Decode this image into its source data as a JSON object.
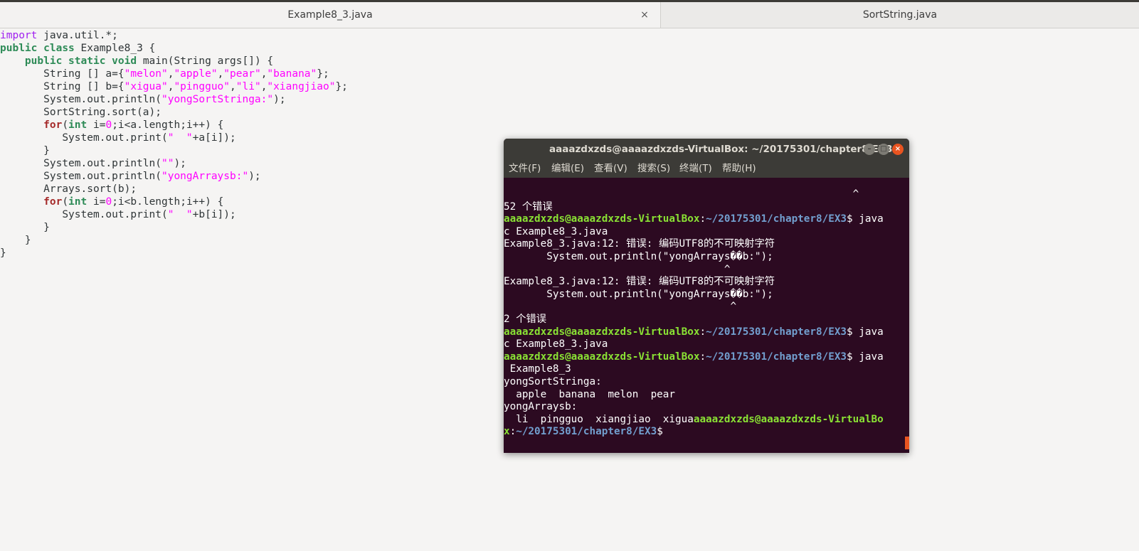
{
  "tabs": [
    {
      "label": "Example8_3.java",
      "active": true
    },
    {
      "label": "SortString.java",
      "active": false
    }
  ],
  "tab_close_glyph": "×",
  "editor": {
    "code": [
      {
        "indent": "",
        "parts": [
          {
            "t": "import",
            "c": "kw1"
          },
          {
            "t": " java.util.*;",
            "c": ""
          }
        ]
      },
      {
        "indent": "",
        "parts": [
          {
            "t": "public",
            "c": "kw2"
          },
          {
            "t": " ",
            "c": ""
          },
          {
            "t": "class",
            "c": "kw2"
          },
          {
            "t": " Example8_3 {",
            "c": ""
          }
        ]
      },
      {
        "indent": "    ",
        "parts": [
          {
            "t": "public",
            "c": "kw2"
          },
          {
            "t": " ",
            "c": ""
          },
          {
            "t": "static",
            "c": "kw2"
          },
          {
            "t": " ",
            "c": ""
          },
          {
            "t": "void",
            "c": "kw2"
          },
          {
            "t": " main(String args[]) {",
            "c": ""
          }
        ]
      },
      {
        "indent": "       ",
        "parts": [
          {
            "t": "String [] a={",
            "c": ""
          },
          {
            "t": "\"melon\"",
            "c": "str"
          },
          {
            "t": ",",
            "c": ""
          },
          {
            "t": "\"apple\"",
            "c": "str"
          },
          {
            "t": ",",
            "c": ""
          },
          {
            "t": "\"pear\"",
            "c": "str"
          },
          {
            "t": ",",
            "c": ""
          },
          {
            "t": "\"banana\"",
            "c": "str"
          },
          {
            "t": "};",
            "c": ""
          }
        ]
      },
      {
        "indent": "       ",
        "parts": [
          {
            "t": "String [] b={",
            "c": ""
          },
          {
            "t": "\"xigua\"",
            "c": "str"
          },
          {
            "t": ",",
            "c": ""
          },
          {
            "t": "\"pingguo\"",
            "c": "str"
          },
          {
            "t": ",",
            "c": ""
          },
          {
            "t": "\"li\"",
            "c": "str"
          },
          {
            "t": ",",
            "c": ""
          },
          {
            "t": "\"xiangjiao\"",
            "c": "str"
          },
          {
            "t": "};",
            "c": ""
          }
        ]
      },
      {
        "indent": "       ",
        "parts": [
          {
            "t": "System.out.println(",
            "c": ""
          },
          {
            "t": "\"yongSortStringa:\"",
            "c": "str"
          },
          {
            "t": ");",
            "c": ""
          }
        ]
      },
      {
        "indent": "       ",
        "parts": [
          {
            "t": "SortString.sort(a);",
            "c": ""
          }
        ]
      },
      {
        "indent": "       ",
        "parts": [
          {
            "t": "for",
            "c": "kw3"
          },
          {
            "t": "(",
            "c": ""
          },
          {
            "t": "int",
            "c": "kw2"
          },
          {
            "t": " i=",
            "c": ""
          },
          {
            "t": "0",
            "c": "num"
          },
          {
            "t": ";i<a.length;i++) {",
            "c": ""
          }
        ]
      },
      {
        "indent": "          ",
        "parts": [
          {
            "t": "System.out.print(",
            "c": ""
          },
          {
            "t": "\"  \"",
            "c": "str"
          },
          {
            "t": "+a[i]);",
            "c": ""
          }
        ]
      },
      {
        "indent": "       ",
        "parts": [
          {
            "t": "}",
            "c": ""
          }
        ]
      },
      {
        "indent": "       ",
        "parts": [
          {
            "t": "System.out.println(",
            "c": ""
          },
          {
            "t": "\"\"",
            "c": "str"
          },
          {
            "t": ");",
            "c": ""
          }
        ]
      },
      {
        "indent": "       ",
        "parts": [
          {
            "t": "System.out.println(",
            "c": ""
          },
          {
            "t": "\"yongArraysb:\"",
            "c": "str"
          },
          {
            "t": ");",
            "c": ""
          }
        ]
      },
      {
        "indent": "       ",
        "parts": [
          {
            "t": "Arrays.sort(b);",
            "c": ""
          }
        ]
      },
      {
        "indent": "       ",
        "parts": [
          {
            "t": "for",
            "c": "kw3"
          },
          {
            "t": "(",
            "c": ""
          },
          {
            "t": "int",
            "c": "kw2"
          },
          {
            "t": " i=",
            "c": ""
          },
          {
            "t": "0",
            "c": "num"
          },
          {
            "t": ";i<b.length;i++) {",
            "c": ""
          }
        ]
      },
      {
        "indent": "          ",
        "parts": [
          {
            "t": "System.out.print(",
            "c": ""
          },
          {
            "t": "\"  \"",
            "c": "str"
          },
          {
            "t": "+b[i]);",
            "c": ""
          }
        ]
      },
      {
        "indent": "       ",
        "parts": [
          {
            "t": "}",
            "c": ""
          }
        ]
      },
      {
        "indent": "    ",
        "parts": [
          {
            "t": "}",
            "c": ""
          }
        ]
      },
      {
        "indent": "",
        "parts": [
          {
            "t": "}",
            "c": ""
          }
        ]
      }
    ]
  },
  "terminal": {
    "title": "aaaazdxzds@aaaazdxzds-VirtualBox: ~/20175301/chapter8/EX3",
    "window_buttons": {
      "minimize": "–",
      "maximize": "□",
      "close": "×"
    },
    "menu": [
      "文件(F)",
      "编辑(E)",
      "查看(V)",
      "搜索(S)",
      "终端(T)",
      "帮助(H)"
    ],
    "lines": [
      [
        {
          "t": "                                                         ^",
          "c": ""
        }
      ],
      [
        {
          "t": "52 个错误",
          "c": ""
        }
      ],
      [
        {
          "t": "aaaazdxzds@aaaazdxzds-VirtualBox",
          "c": "pu"
        },
        {
          "t": ":",
          "c": ""
        },
        {
          "t": "~/20175301/chapter8/EX3",
          "c": "pp"
        },
        {
          "t": "$ java",
          "c": ""
        }
      ],
      [
        {
          "t": "c Example8_3.java",
          "c": ""
        }
      ],
      [
        {
          "t": "Example8_3.java:12: 错误: 编码UTF8的不可映射字符",
          "c": ""
        }
      ],
      [
        {
          "t": "       System.out.println(\"yongArrays��b:\");",
          "c": ""
        }
      ],
      [
        {
          "t": "                                    ^",
          "c": ""
        }
      ],
      [
        {
          "t": "Example8_3.java:12: 错误: 编码UTF8的不可映射字符",
          "c": ""
        }
      ],
      [
        {
          "t": "       System.out.println(\"yongArrays��b:\");",
          "c": ""
        }
      ],
      [
        {
          "t": "                                     ^",
          "c": ""
        }
      ],
      [
        {
          "t": "2 个错误",
          "c": ""
        }
      ],
      [
        {
          "t": "aaaazdxzds@aaaazdxzds-VirtualBox",
          "c": "pu"
        },
        {
          "t": ":",
          "c": ""
        },
        {
          "t": "~/20175301/chapter8/EX3",
          "c": "pp"
        },
        {
          "t": "$ java",
          "c": ""
        }
      ],
      [
        {
          "t": "c Example8_3.java",
          "c": ""
        }
      ],
      [
        {
          "t": "aaaazdxzds@aaaazdxzds-VirtualBox",
          "c": "pu"
        },
        {
          "t": ":",
          "c": ""
        },
        {
          "t": "~/20175301/chapter8/EX3",
          "c": "pp"
        },
        {
          "t": "$ java",
          "c": ""
        }
      ],
      [
        {
          "t": " Example8_3",
          "c": ""
        }
      ],
      [
        {
          "t": "yongSortStringa:",
          "c": ""
        }
      ],
      [
        {
          "t": "  apple  banana  melon  pear",
          "c": ""
        }
      ],
      [
        {
          "t": "yongArraysb:",
          "c": ""
        }
      ],
      [
        {
          "t": "  li  pingguo  xiangjiao  xigua",
          "c": ""
        },
        {
          "t": "aaaazdxzds@aaaazdxzds-VirtualBo",
          "c": "pu"
        }
      ],
      [
        {
          "t": "x",
          "c": "pu"
        },
        {
          "t": ":",
          "c": ""
        },
        {
          "t": "~/20175301/chapter8/EX3",
          "c": "pp"
        },
        {
          "t": "$",
          "c": ""
        }
      ]
    ]
  }
}
